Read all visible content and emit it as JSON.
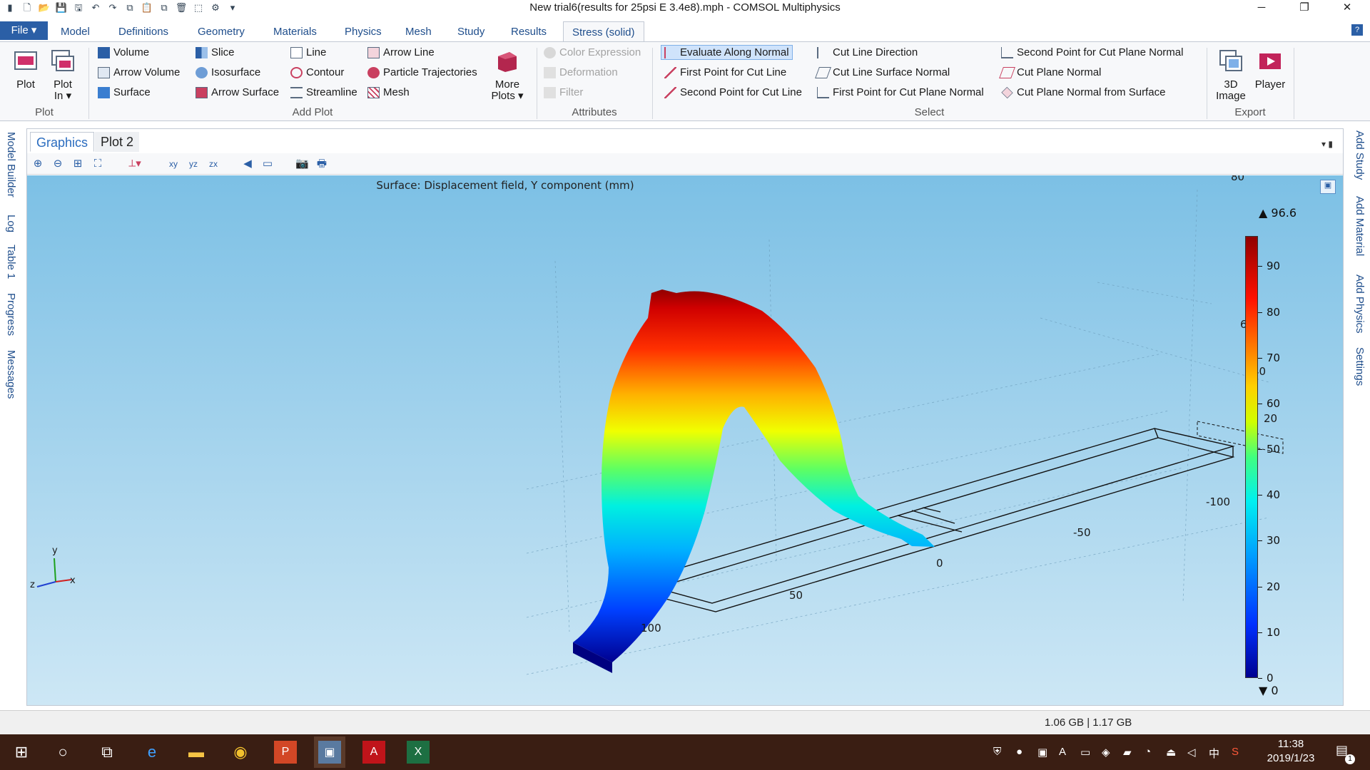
{
  "window": {
    "title": "New trial6(results for 25psi E 3.4e8).mph - COMSOL Multiphysics",
    "minimize": "─",
    "restore": "❐",
    "close": "✕"
  },
  "ribbon_tabs": {
    "file": "File ▾",
    "tabs": [
      "Model",
      "Definitions",
      "Geometry",
      "Materials",
      "Physics",
      "Mesh",
      "Study",
      "Results",
      "Stress (solid)"
    ],
    "help": "?"
  },
  "ribbon": {
    "plot_group": {
      "label": "Plot",
      "plot": "Plot",
      "plot_in_1": "Plot",
      "plot_in_2": "In ▾"
    },
    "add_plot_group": {
      "label": "Add Plot",
      "col1": [
        "Volume",
        "Arrow Volume",
        "Surface"
      ],
      "col2": [
        "Slice",
        "Isosurface",
        "Arrow Surface"
      ],
      "col3": [
        "Line",
        "Contour",
        "Streamline"
      ],
      "col4": [
        "Arrow Line",
        "Particle Trajectories",
        "Mesh"
      ],
      "more_1": "More",
      "more_2": "Plots ▾"
    },
    "attributes_group": {
      "label": "Attributes",
      "items": [
        "Color Expression",
        "Deformation",
        "Filter"
      ]
    },
    "select_group": {
      "label": "Select",
      "col1": [
        "Evaluate Along Normal",
        "First Point for Cut Line",
        "Second Point for Cut Line"
      ],
      "col2": [
        "Cut Line Direction",
        "Cut Line Surface Normal",
        "First Point for Cut Plane Normal"
      ],
      "col3": [
        "Second Point for Cut Plane Normal",
        "Cut Plane Normal",
        "Cut Plane Normal from Surface"
      ]
    },
    "export_group": {
      "label": "Export",
      "image_1": "3D",
      "image_2": "Image",
      "player": "Player"
    }
  },
  "left_strip": [
    "Model Builder",
    "Log",
    "Table 1",
    "Progress",
    "Messages"
  ],
  "right_strip": [
    "Add Study",
    "Add Material",
    "Add Physics",
    "Settings"
  ],
  "graphics": {
    "tabs": [
      "Graphics",
      "Plot 2"
    ],
    "plot_title": "Surface: Displacement field, Y component (mm)",
    "toolbar_labels": {
      "xy": "xy",
      "yz": "yz",
      "zx": "zx"
    },
    "axis_labels": {
      "x": "x",
      "y": "y",
      "z": "z"
    },
    "grid_labels": {
      "front": [
        "100",
        "50",
        "0",
        "-50",
        "-100"
      ],
      "vertical": [
        "60",
        "40",
        "20",
        "80"
      ]
    },
    "colorbar": {
      "max_label": "▲ 96.6",
      "min_label": "▼ 0",
      "ticks": [
        "90",
        "80",
        "70",
        "60",
        "50",
        "40",
        "30",
        "20",
        "10",
        "0"
      ],
      "max": 96.6,
      "min": 0
    }
  },
  "status": {
    "memory": "1.06 GB | 1.17 GB"
  },
  "taskbar": {
    "time": "11:38",
    "date": "2019/1/23",
    "ime": "中",
    "notifications": "1"
  }
}
